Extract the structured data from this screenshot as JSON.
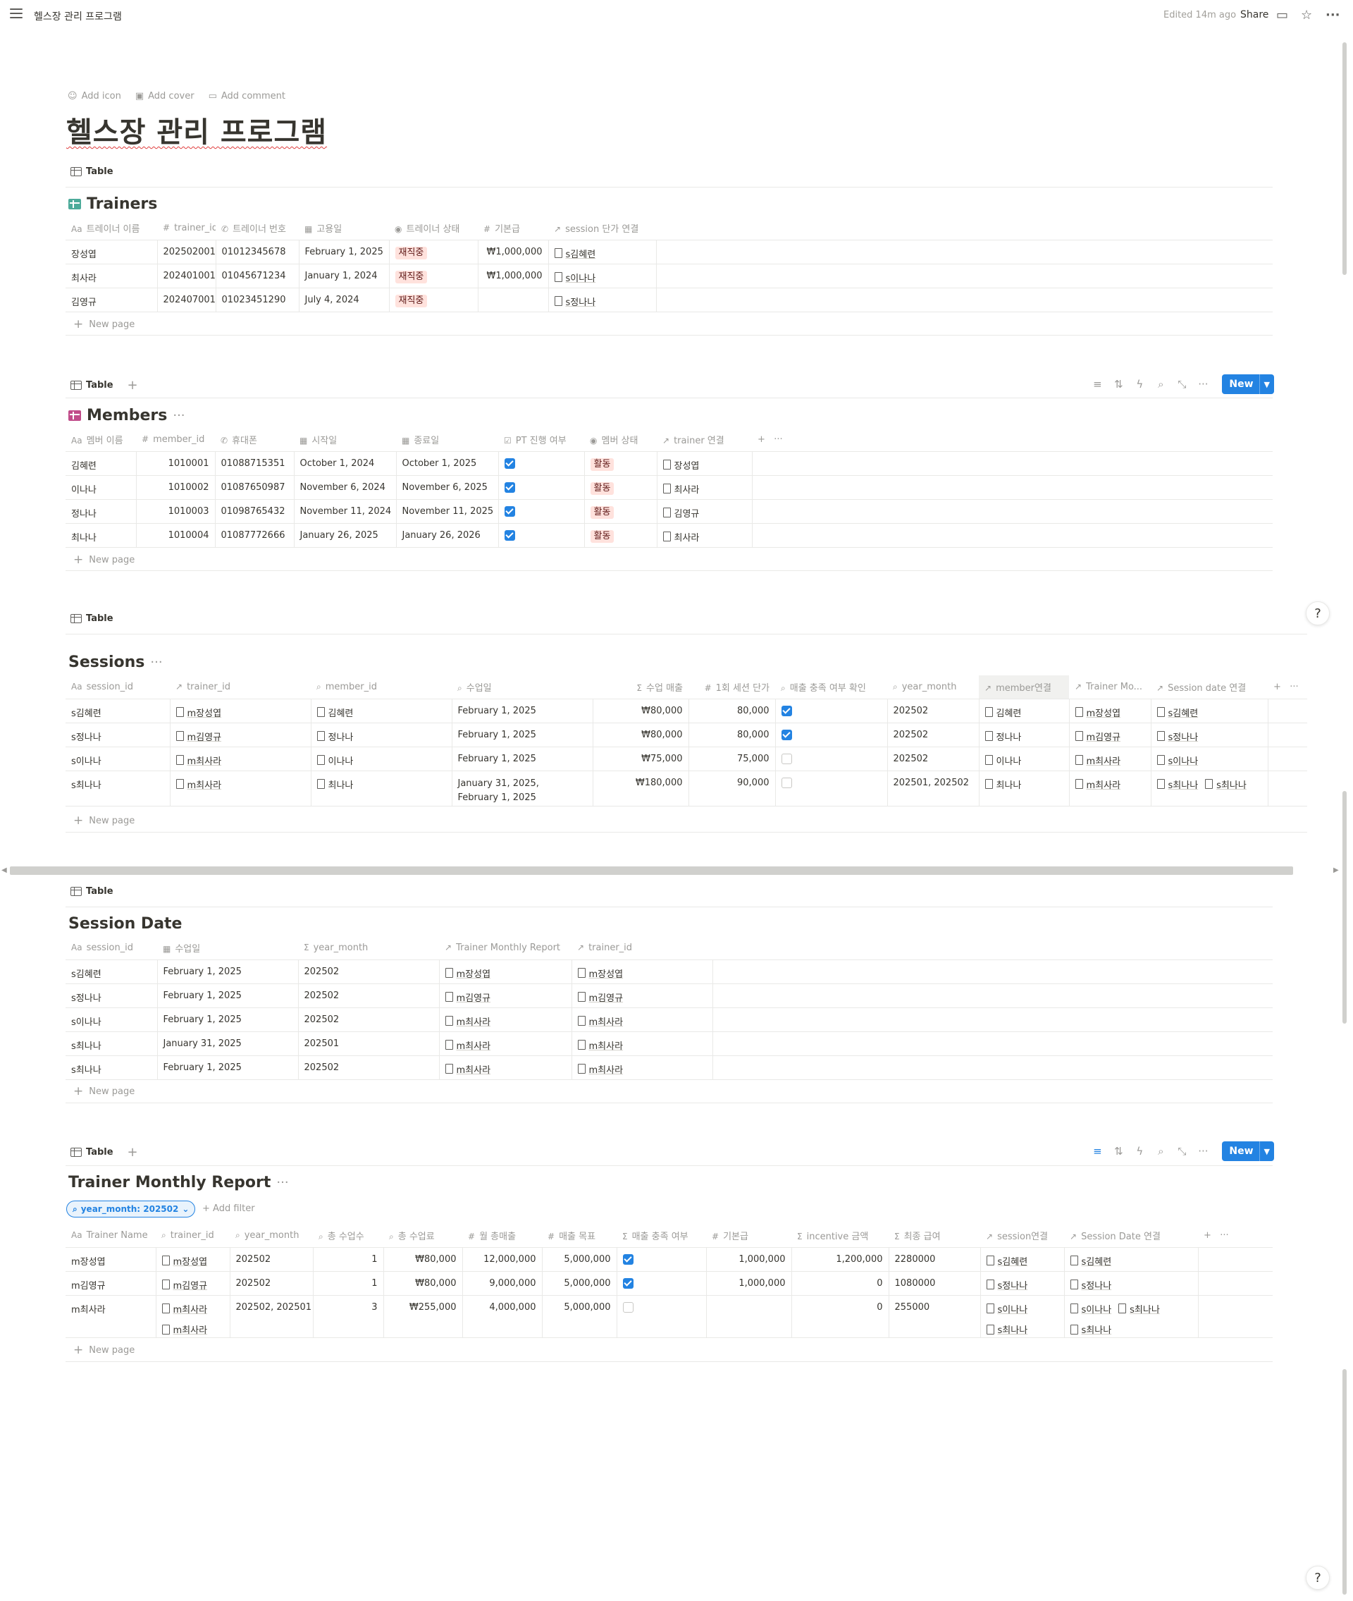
{
  "topbar": {
    "breadcrumb": "헬스장 관리 프로그램",
    "edited": "Edited 14m ago",
    "share": "Share"
  },
  "page": {
    "add_icon": "Add icon",
    "add_cover": "Add cover",
    "add_comment": "Add comment",
    "title": "헬스장 관리 프로그램"
  },
  "view_label": "Table",
  "new_page": "New page",
  "new_button": "New",
  "trainers": {
    "title": "Trainers",
    "columns": [
      "트레이너 이름",
      "trainer_id",
      "트레이너 번호",
      "고용일",
      "트레이너 상태",
      "기본급",
      "session 단가 연결"
    ],
    "rows": [
      {
        "name": "장성엽",
        "id": "202502001",
        "phone": "01012345678",
        "hired": "February 1, 2025",
        "status": "재직중",
        "base": "₩1,000,000",
        "session": "s김혜련"
      },
      {
        "name": "최사라",
        "id": "202401001",
        "phone": "01045671234",
        "hired": "January 1, 2024",
        "status": "재직중",
        "base": "₩1,000,000",
        "session": "s이나나"
      },
      {
        "name": "김영규",
        "id": "202407001",
        "phone": "01023451290",
        "hired": "July 4, 2024",
        "status": "재직중",
        "base": "",
        "session": "s정나나"
      }
    ]
  },
  "members": {
    "title": "Members",
    "columns": [
      "멤버 이름",
      "member_id",
      "휴대폰",
      "시작일",
      "종료일",
      "PT 진행 여부",
      "멤버 상태",
      "trainer 연결"
    ],
    "rows": [
      {
        "name": "김혜련",
        "id": "1010001",
        "phone": "01088715351",
        "start": "October 1, 2024",
        "end": "October 1, 2025",
        "pt": true,
        "status": "활동",
        "trainer": "장성엽"
      },
      {
        "name": "이나나",
        "id": "1010002",
        "phone": "01087650987",
        "start": "November 6, 2024",
        "end": "November 6, 2025",
        "pt": true,
        "status": "활동",
        "trainer": "최사라"
      },
      {
        "name": "정나나",
        "id": "1010003",
        "phone": "01098765432",
        "start": "November 11, 2024",
        "end": "November 11, 2025",
        "pt": true,
        "status": "활동",
        "trainer": "김영규"
      },
      {
        "name": "최나나",
        "id": "1010004",
        "phone": "01087772666",
        "start": "January 26, 2025",
        "end": "January 26, 2026",
        "pt": true,
        "status": "활동",
        "trainer": "최사라"
      }
    ]
  },
  "sessions": {
    "title": "Sessions",
    "columns": [
      "session_id",
      "trainer_id",
      "member_id",
      "수업일",
      "수업 매출",
      "1회 세션 단가",
      "매출 충족 여부 확인",
      "year_month",
      "member연결",
      "Trainer Mo...",
      "Session date 연결"
    ],
    "rows": [
      {
        "id": "s김혜련",
        "trainer": "m장성엽",
        "member": "김혜련",
        "date1": "February 1, 2025",
        "date2": "",
        "revenue": "₩80,000",
        "price": "80,000",
        "met": true,
        "ym": "202502",
        "mlink": "김혜련",
        "tm": "m장성엽",
        "sd1": "s김혜련",
        "sd2": ""
      },
      {
        "id": "s정나나",
        "trainer": "m김영규",
        "member": "정나나",
        "date1": "February 1, 2025",
        "date2": "",
        "revenue": "₩80,000",
        "price": "80,000",
        "met": true,
        "ym": "202502",
        "mlink": "정나나",
        "tm": "m김영규",
        "sd1": "s정나나",
        "sd2": ""
      },
      {
        "id": "s이나나",
        "trainer": "m최사라",
        "member": "이나나",
        "date1": "February 1, 2025",
        "date2": "",
        "revenue": "₩75,000",
        "price": "75,000",
        "met": false,
        "ym": "202502",
        "mlink": "이나나",
        "tm": "m최사라",
        "sd1": "s이나나",
        "sd2": ""
      },
      {
        "id": "s최나나",
        "trainer": "m최사라",
        "member": "최나나",
        "date1": "January 31, 2025,",
        "date2": "February 1, 2025",
        "revenue": "₩180,000",
        "price": "90,000",
        "met": false,
        "ym": "202501, 202502",
        "mlink": "최나나",
        "tm": "m최사라",
        "sd1": "s최나나",
        "sd2": "s최나나"
      }
    ]
  },
  "session_date": {
    "title": "Session Date",
    "columns": [
      "session_id",
      "수업일",
      "year_month",
      "Trainer Monthly Report",
      "trainer_id"
    ],
    "rows": [
      {
        "id": "s김혜련",
        "date": "February 1, 2025",
        "ym": "202502",
        "report": "m장성엽",
        "trainer": "m장성엽"
      },
      {
        "id": "s정나나",
        "date": "February 1, 2025",
        "ym": "202502",
        "report": "m김영규",
        "trainer": "m김영규"
      },
      {
        "id": "s이나나",
        "date": "February 1, 2025",
        "ym": "202502",
        "report": "m최사라",
        "trainer": "m최사라"
      },
      {
        "id": "s최나나",
        "date": "January 31, 2025",
        "ym": "202501",
        "report": "m최사라",
        "trainer": "m최사라"
      },
      {
        "id": "s최나나",
        "date": "February 1, 2025",
        "ym": "202502",
        "report": "m최사라",
        "trainer": "m최사라"
      }
    ]
  },
  "report": {
    "title": "Trainer Monthly Report",
    "filter": "year_month: 202502",
    "add_filter": "Add filter",
    "columns": [
      "Trainer Name",
      "trainer_id",
      "year_month",
      "총 수업수",
      "총 수업료",
      "월 총매출",
      "매출 목표",
      "매출 충족 여부",
      "기본급",
      "incentive 금액",
      "최종 급여",
      "session연결",
      "Session Date 연결"
    ],
    "rows": [
      {
        "name": "m장성엽",
        "tid1": "m장성엽",
        "tid2": "",
        "ym": "202502",
        "count": "1",
        "fee": "₩80,000",
        "monthly": "12,000,000",
        "target": "5,000,000",
        "met": true,
        "base": "1,000,000",
        "incentive": "1,200,000",
        "final": "2280000",
        "s1": "s김혜련",
        "s2": "",
        "sd1": "s김혜련",
        "sd2": "",
        "sd3": ""
      },
      {
        "name": "m김영규",
        "tid1": "m김영규",
        "tid2": "",
        "ym": "202502",
        "count": "1",
        "fee": "₩80,000",
        "monthly": "9,000,000",
        "target": "5,000,000",
        "met": true,
        "base": "1,000,000",
        "incentive": "0",
        "final": "1080000",
        "s1": "s정나나",
        "s2": "",
        "sd1": "s정나나",
        "sd2": "",
        "sd3": ""
      },
      {
        "name": "m최사라",
        "tid1": "m최사라",
        "tid2": "m최사라",
        "ym": "202502, 202501",
        "count": "3",
        "fee": "₩255,000",
        "monthly": "4,000,000",
        "target": "5,000,000",
        "met": false,
        "base": "",
        "incentive": "0",
        "final": "255000",
        "s1": "s이나나",
        "s2": "s최나나",
        "sd1": "s이나나",
        "sd2": "s최나나",
        "sd3": "s최나나"
      }
    ]
  }
}
